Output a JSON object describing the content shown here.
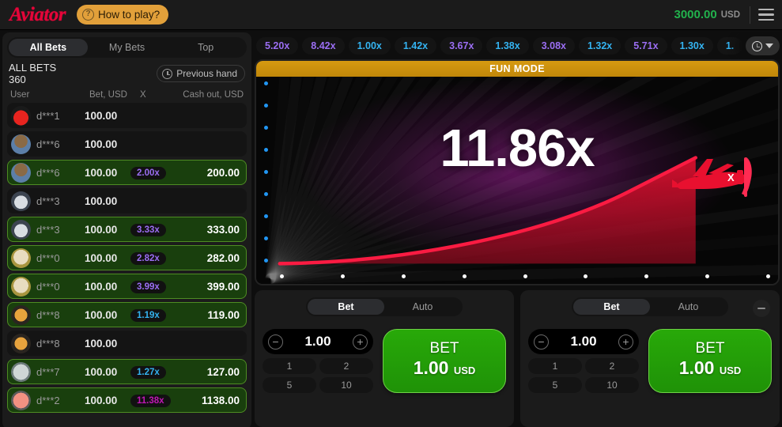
{
  "header": {
    "logo": "Aviator",
    "how_to_play": "How to play?",
    "balance": "3000.00",
    "currency": "USD"
  },
  "sidebar": {
    "tabs": [
      {
        "label": "All Bets",
        "active": true
      },
      {
        "label": "My Bets",
        "active": false
      },
      {
        "label": "Top",
        "active": false
      }
    ],
    "all_bets_label": "ALL BETS",
    "all_bets_count": "360",
    "previous_hand": "Previous hand",
    "columns": {
      "user": "User",
      "bet": "Bet, USD",
      "x": "X",
      "cashout": "Cash out, USD"
    },
    "rows": [
      {
        "user": "d***1",
        "bet": "100.00",
        "x": "",
        "cashout": "",
        "win": false,
        "avatar": "car-red"
      },
      {
        "user": "d***6",
        "bet": "100.00",
        "x": "",
        "cashout": "",
        "win": false,
        "avatar": "person-brown"
      },
      {
        "user": "d***6",
        "bet": "100.00",
        "x": "2.00x",
        "cashout": "200.00",
        "win": true,
        "avatar": "person-brown"
      },
      {
        "user": "d***3",
        "bet": "100.00",
        "x": "",
        "cashout": "",
        "win": false,
        "avatar": "car-silver"
      },
      {
        "user": "d***3",
        "bet": "100.00",
        "x": "3.33x",
        "cashout": "333.00",
        "win": true,
        "avatar": "car-silver"
      },
      {
        "user": "d***0",
        "bet": "100.00",
        "x": "2.82x",
        "cashout": "282.00",
        "win": true,
        "avatar": "dog-tan"
      },
      {
        "user": "d***0",
        "bet": "100.00",
        "x": "3.99x",
        "cashout": "399.00",
        "win": true,
        "avatar": "dog-tan"
      },
      {
        "user": "d***8",
        "bet": "100.00",
        "x": "1.19x",
        "cashout": "119.00",
        "win": true,
        "avatar": "tiger"
      },
      {
        "user": "d***8",
        "bet": "100.00",
        "x": "",
        "cashout": "",
        "win": false,
        "avatar": "tiger"
      },
      {
        "user": "d***7",
        "bet": "100.00",
        "x": "1.27x",
        "cashout": "127.00",
        "win": true,
        "avatar": "plane-grey"
      },
      {
        "user": "d***2",
        "bet": "100.00",
        "x": "11.38x",
        "cashout": "1138.00",
        "win": true,
        "avatar": "engine-pink"
      }
    ]
  },
  "history": {
    "multipliers": [
      "5.20x",
      "8.42x",
      "1.00x",
      "1.42x",
      "3.67x",
      "1.38x",
      "3.08x",
      "1.32x",
      "5.71x",
      "1.30x",
      "1."
    ],
    "toggle_icon": "history-icon"
  },
  "game": {
    "mode_banner": "FUN MODE",
    "current_multiplier": "11.86x",
    "plane_icon": "plane-icon"
  },
  "colors": {
    "mult_low": "#34b3f1",
    "mult_mid": "#9b6ef3",
    "mult_high": "#c017b4",
    "accent_green": "#22b14c",
    "brand_red": "#e50539",
    "fun_mode_bg": "#c08709"
  },
  "bet_panels": [
    {
      "tabs": [
        {
          "label": "Bet",
          "active": true
        },
        {
          "label": "Auto",
          "active": false
        }
      ],
      "stake": "1.00",
      "minus": "−",
      "plus": "+",
      "quick_amounts": [
        "1",
        "2",
        "5",
        "10"
      ],
      "button_label": "BET",
      "button_value": "1.00",
      "button_currency": "USD",
      "has_collapse": false
    },
    {
      "tabs": [
        {
          "label": "Bet",
          "active": true
        },
        {
          "label": "Auto",
          "active": false
        }
      ],
      "stake": "1.00",
      "minus": "−",
      "plus": "+",
      "quick_amounts": [
        "1",
        "2",
        "5",
        "10"
      ],
      "button_label": "BET",
      "button_value": "1.00",
      "button_currency": "USD",
      "has_collapse": true
    }
  ]
}
